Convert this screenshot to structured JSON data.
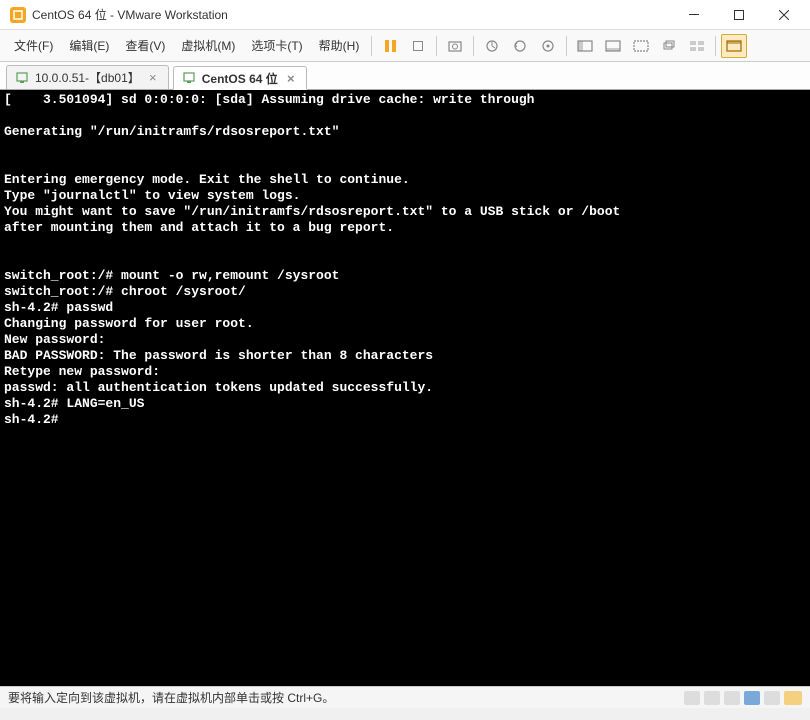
{
  "titlebar": {
    "title": "CentOS 64 位 - VMware Workstation"
  },
  "menus": {
    "file": "文件(F)",
    "edit": "编辑(E)",
    "view": "查看(V)",
    "vm": "虚拟机(M)",
    "tabs": "选项卡(T)",
    "help": "帮助(H)"
  },
  "tabs": [
    {
      "label": "10.0.0.51-【db01】",
      "active": false
    },
    {
      "label": "CentOS 64 位",
      "active": true
    }
  ],
  "terminal_lines": [
    "[    3.501094] sd 0:0:0:0: [sda] Assuming drive cache: write through",
    "",
    "Generating \"/run/initramfs/rdsosreport.txt\"",
    "",
    "",
    "Entering emergency mode. Exit the shell to continue.",
    "Type \"journalctl\" to view system logs.",
    "You might want to save \"/run/initramfs/rdsosreport.txt\" to a USB stick or /boot",
    "after mounting them and attach it to a bug report.",
    "",
    "",
    "switch_root:/# mount -o rw,remount /sysroot",
    "switch_root:/# chroot /sysroot/",
    "sh-4.2# passwd",
    "Changing password for user root.",
    "New password:",
    "BAD PASSWORD: The password is shorter than 8 characters",
    "Retype new password:",
    "passwd: all authentication tokens updated successfully.",
    "sh-4.2# LANG=en_US",
    "sh-4.2#"
  ],
  "statusbar": {
    "text": "要将输入定向到该虚拟机，请在虚拟机内部单击或按 Ctrl+G。"
  }
}
